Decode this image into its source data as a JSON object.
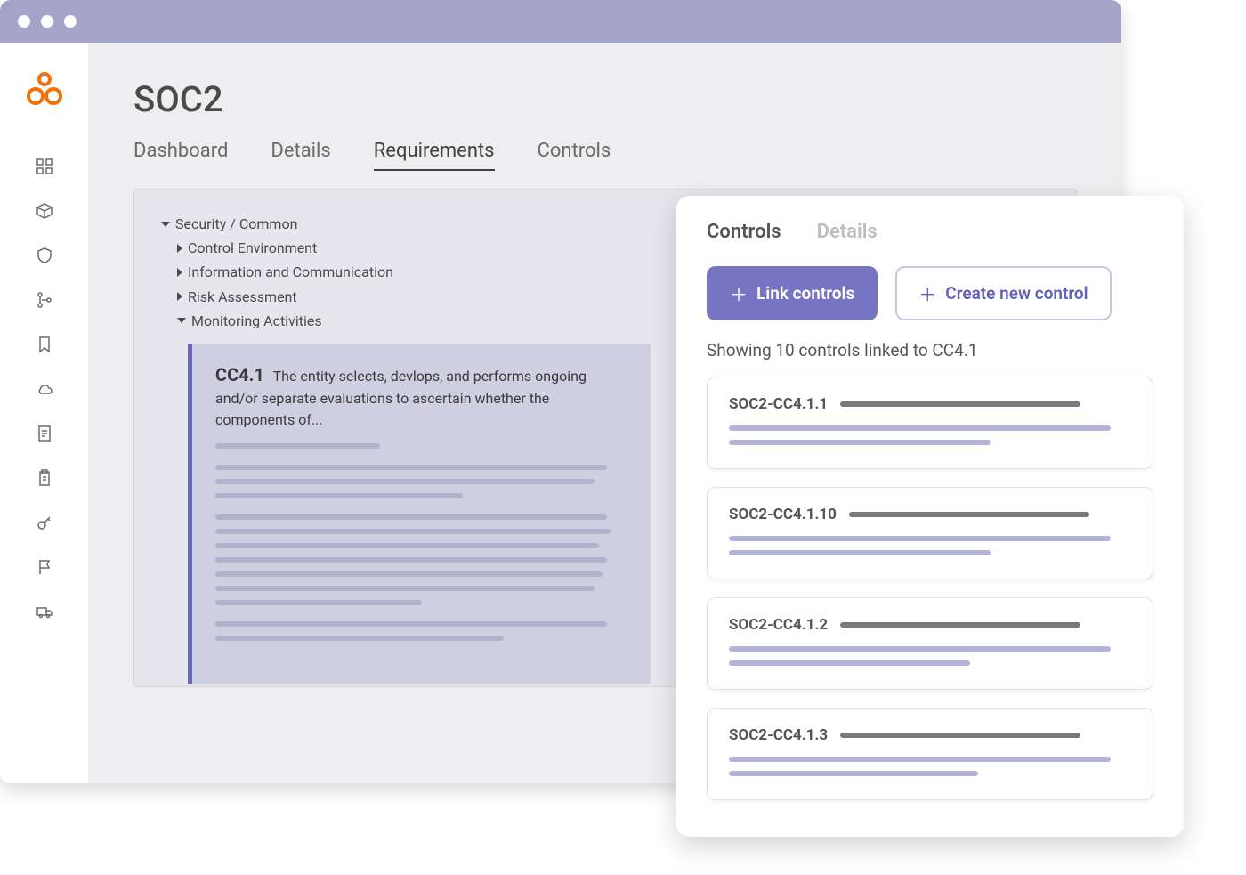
{
  "page_title": "SOC2",
  "tabs": [
    "Dashboard",
    "Details",
    "Requirements",
    "Controls"
  ],
  "active_tab": "Requirements",
  "tree": {
    "root": "Security / Common",
    "children": [
      "Control Environment",
      "Information and Communication",
      "Risk Assessment",
      "Monitoring Activities"
    ]
  },
  "requirement": {
    "code": "CC4.1",
    "text": "The entity selects, devlops, and performs ongoing and/or separate evaluations to ascertain whether the components of..."
  },
  "side_panel": {
    "tabs": [
      "Controls",
      "Details"
    ],
    "active_tab": "Controls",
    "link_btn": "Link controls",
    "create_btn": "Create new control",
    "summary": "Showing 10 controls linked to CC4.1",
    "cards": [
      {
        "id": "SOC2-CC4.1.1"
      },
      {
        "id": "SOC2-CC4.1.10"
      },
      {
        "id": "SOC2-CC4.1.2"
      },
      {
        "id": "SOC2-CC4.1.3"
      }
    ]
  },
  "sidebar_icons": [
    "dashboard-icon",
    "package-icon",
    "shield-icon",
    "branch-icon",
    "bookmark-icon",
    "cloud-icon",
    "document-icon",
    "clipboard-icon",
    "key-icon",
    "flag-icon",
    "truck-icon"
  ]
}
